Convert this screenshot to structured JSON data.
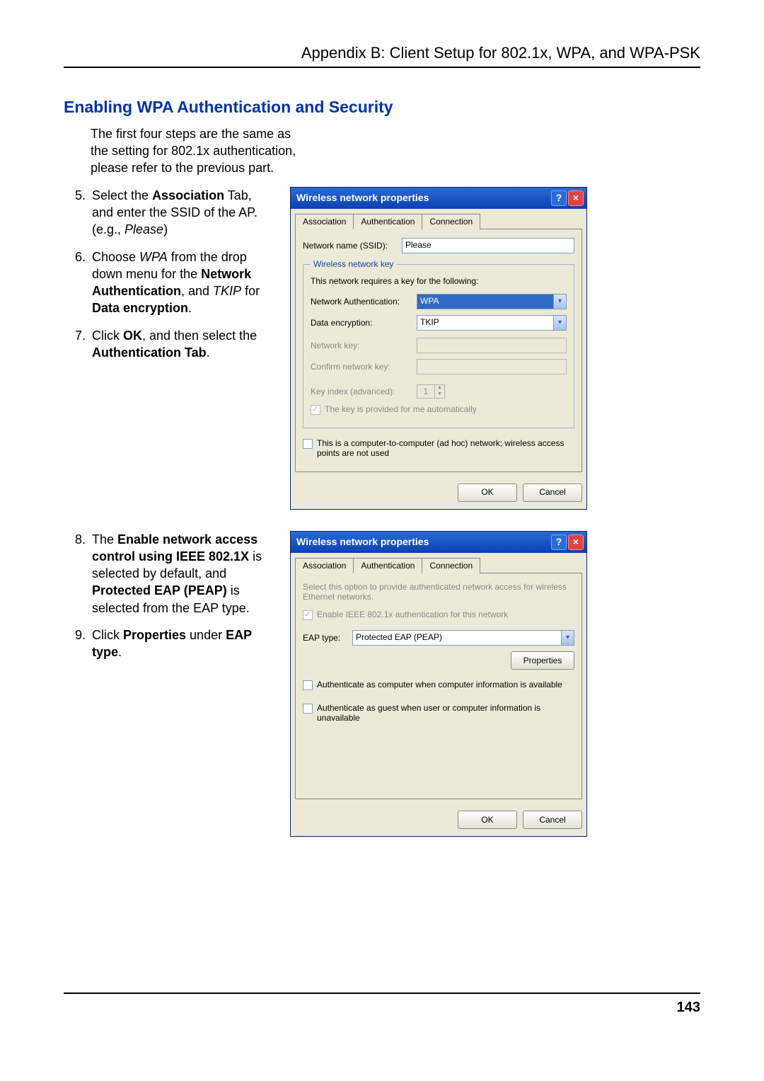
{
  "header": "Appendix B: Client Setup for 802.1x, WPA, and WPA-PSK",
  "section_title": "Enabling WPA Authentication and Security",
  "intro": "The first four steps are the same as the setting for 802.1x authentication, please refer to the previous part.",
  "steps1": {
    "start": 5,
    "items": [
      {
        "pre": "Select the ",
        "b1": "Association",
        "mid": " Tab, and enter the SSID of the AP. (e.g., ",
        "i": "Please",
        "post": ")"
      },
      {
        "pre": "Choose ",
        "i1": "WPA",
        "m1": " from the drop down menu for the ",
        "b1": "Network Authentication",
        "m2": ", and ",
        "i2": "TKIP",
        "m3": " for ",
        "b2": "Data encryption",
        "post": "."
      },
      {
        "pre": "Click ",
        "b1": "OK",
        "mid": ", and then select the ",
        "b2": "Authentication Tab",
        "post": "."
      }
    ]
  },
  "steps2": {
    "start": 8,
    "items": [
      {
        "pre": "The ",
        "b1": "Enable network access control using IEEE 802.1X",
        "m1": " is selected by default, and ",
        "b2": "Protected EAP (PEAP)",
        "post": " is selected from the EAP type."
      },
      {
        "pre": "Click ",
        "b1": "Properties",
        "mid": " under ",
        "b2": "EAP type",
        "post": "."
      }
    ]
  },
  "dlg1": {
    "title": "Wireless network properties",
    "tabs": [
      "Association",
      "Authentication",
      "Connection"
    ],
    "active_tab": 0,
    "ssid_label": "Network name (SSID):",
    "ssid_value": "Please",
    "group_legend": "Wireless network key",
    "group_hint": "This network requires a key for the following:",
    "auth_label": "Network Authentication:",
    "auth_value": "WPA",
    "enc_label": "Data encryption:",
    "enc_value": "TKIP",
    "key_label": "Network key:",
    "confirm_label": "Confirm network key:",
    "idx_label": "Key index (advanced):",
    "idx_value": "1",
    "auto_key": "The key is provided for me automatically",
    "adhoc": "This is a computer-to-computer (ad hoc) network; wireless access points are not used",
    "ok": "OK",
    "cancel": "Cancel"
  },
  "dlg2": {
    "title": "Wireless network properties",
    "tabs": [
      "Association",
      "Authentication",
      "Connection"
    ],
    "active_tab": 1,
    "hint": "Select this option to provide authenticated network access for wireless Ethernet networks.",
    "enable_8021x": "Enable IEEE 802.1x authentication for this network",
    "eap_label": "EAP type:",
    "eap_value": "Protected EAP (PEAP)",
    "properties": "Properties",
    "auth_comp": "Authenticate as computer when computer information is available",
    "auth_guest": "Authenticate as guest when user or computer information is unavailable",
    "ok": "OK",
    "cancel": "Cancel"
  },
  "page_number": "143"
}
